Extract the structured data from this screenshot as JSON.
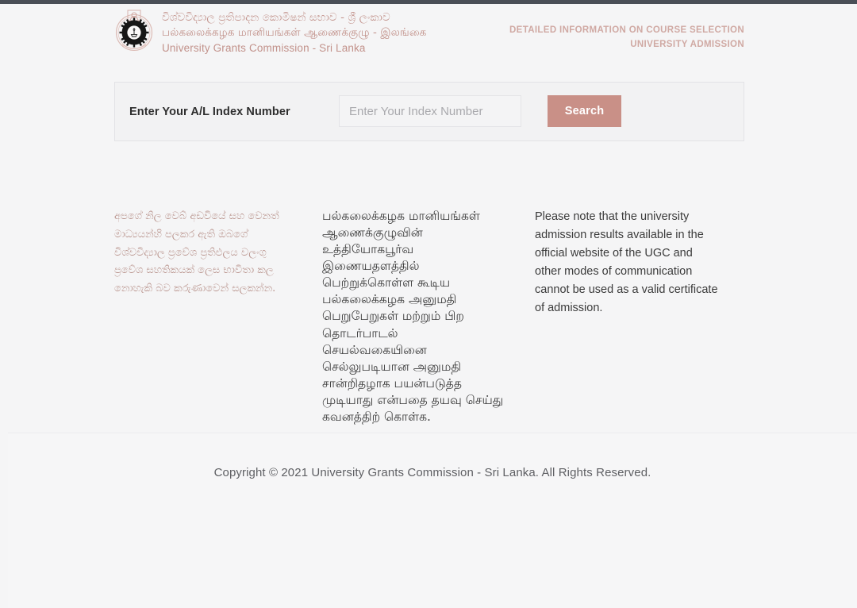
{
  "header": {
    "logo_icon": "ugc-emblem-icon",
    "brand_sinhala": "විශ්වවිද්‍යාල ප්‍රතිපාදන කොමිෂන් සභාව - ශ්‍රී ලංකාව",
    "brand_tamil": "பல்கலைக்கழக மானியங்கள் ஆணைக்குழு - இலங்கை",
    "brand_english": "University Grants Commission - Sri Lanka",
    "tagline_line1": "DETAILED INFORMATION ON COURSE SELECTION",
    "tagline_line2": "UNIVERSITY ADMISSION"
  },
  "search": {
    "label": "Enter Your A/L Index Number",
    "placeholder": "Enter Your Index Number",
    "value": "",
    "button_label": "Search"
  },
  "notices": {
    "sinhala": "අපගේ නිල වෙබ් අඩවියේ සහ වෙනත් මාධ්‍යයන්හි පලකර ඇති ඔබගේ විශ්වවිද්‍යාල ප්‍රවේශ ප්‍රතිඵලය වලංගු ප්‍රවේශ සහතිකයක් ලෙස භාවිතා කල නොහැකි බව කරුණාවෙන් සලකන්න.",
    "tamil": "பல்கலைக்கழக மானியங்கள் ஆணைக்குழுவின் உத்தியோகபூர்வ இணையதளத்தில் பெற்றுக்கொள்ள கூடிய பல்கலைக்கழக அனுமதி பெறுபேறுகள் மற்றும் பிற தொடர்பாடல் செயல்வகையினை செல்லுபடியான அனுமதி சான்றிதழாக பயன்படுத்த முடியாது என்பதை தயவு செய்து கவனத்திற் கொள்க.",
    "english": "Please note that the university admission results available in the official website of the UGC and other modes of communication cannot be used as a valid certificate of admission."
  },
  "footer": {
    "copyright": "Copyright © 2021 University Grants Commission - Sri Lanka. All Rights Reserved."
  },
  "colors": {
    "brand_rose": "#c2928b",
    "button_rose": "#c99087",
    "page_bg": "#f5f5f6",
    "panel_bg": "#f2f2f3",
    "top_strip": "#4a4f57",
    "text_dark": "#3b3b3b"
  }
}
